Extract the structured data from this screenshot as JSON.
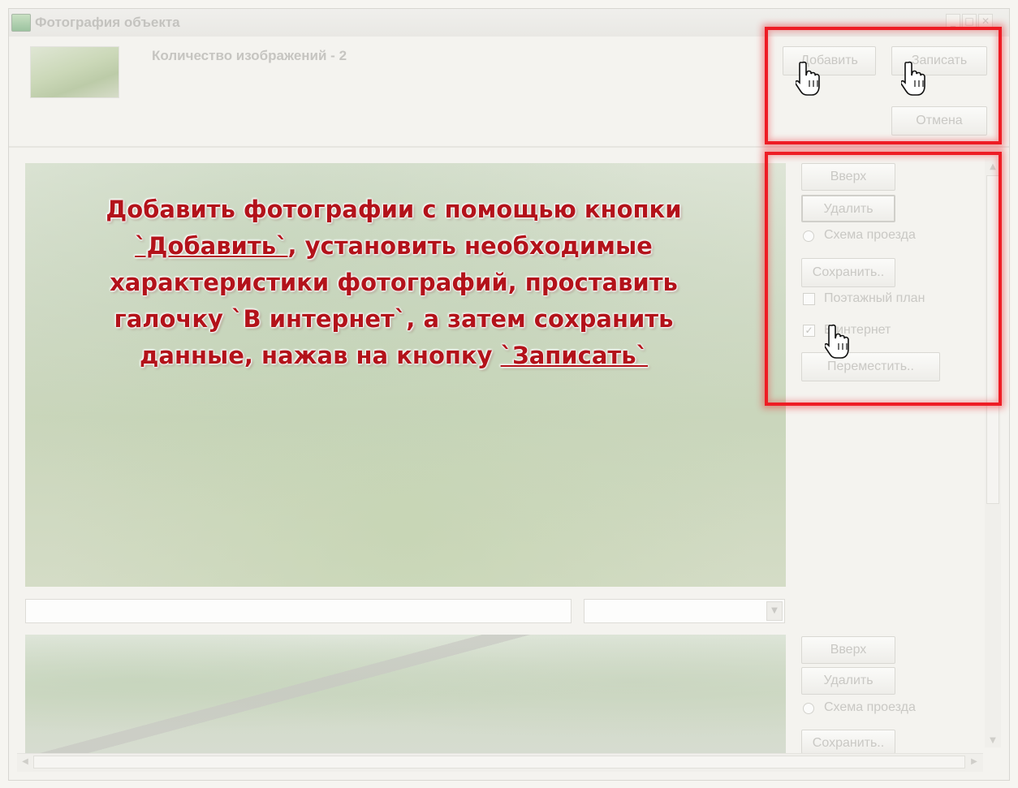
{
  "window": {
    "title": "Фотография объекта",
    "controls": {
      "minimize": "_",
      "maximize": "□",
      "close": "✕"
    }
  },
  "header": {
    "image_count_label": "Количество изображений - 2",
    "add_button": "Добавить",
    "save_button": "Записать",
    "cancel_button": "Отмена"
  },
  "photos": [
    {
      "up_button": "Вверх",
      "delete_button": "Удалить",
      "route_scheme_label": "Схема проезда",
      "save_as_button": "Сохранить..",
      "floor_plan_label": "Поэтажный план",
      "floor_plan_checked": false,
      "internet_label": "В интернет",
      "internet_checked": true,
      "move_button": "Переместить..",
      "description_value": "",
      "type_value": ""
    },
    {
      "up_button": "Вверх",
      "delete_button": "Удалить",
      "route_scheme_label": "Схема проезда",
      "save_as_button": "Сохранить.."
    }
  ],
  "instruction": {
    "line1": "Добавить фотографии с помощью кнопки",
    "add_ref": "`Добавить`",
    "line2_rest": ", установить необходимые",
    "line3": "характеристики фотографий, проставить",
    "line4": "галочку `В интернет`, а затем сохранить",
    "line5_start": "данные, нажав на кнопку ",
    "save_ref": "`Записать`"
  },
  "colors": {
    "highlight": "#ee1c24",
    "instruction_text": "#b3121a"
  },
  "icons": {
    "pointer": "hand-pointer-icon"
  }
}
